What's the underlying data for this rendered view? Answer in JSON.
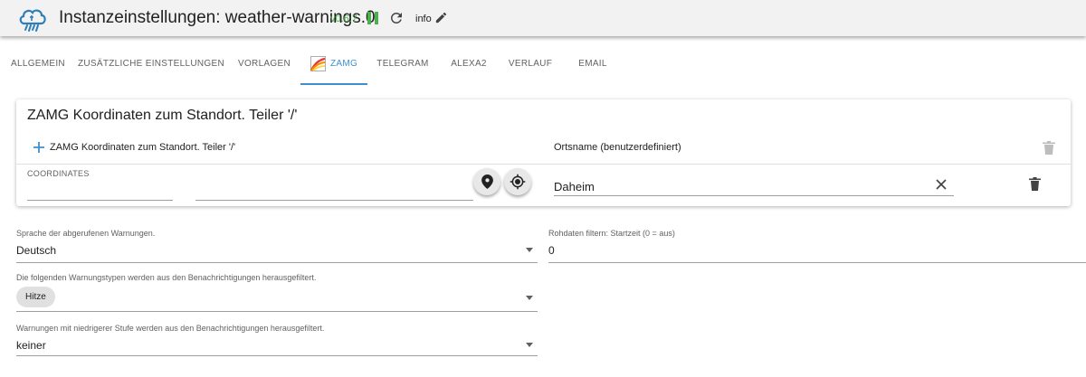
{
  "header": {
    "title": "Instanzeinstellungen: weather-warnings.0",
    "version": "v0.6.7",
    "info_label": "info",
    "colors": {
      "background": "#f2f2f2",
      "version": "#4caf50",
      "accent": "#3f8fcf"
    },
    "icons": [
      "app-logo-icon",
      "pause-icon",
      "refresh-icon",
      "pencil-icon"
    ]
  },
  "tabs": [
    {
      "label": "ALLGEMEIN",
      "active": false
    },
    {
      "label": "ZUSÄTZLICHE EINSTELLUNGEN",
      "active": false
    },
    {
      "label": "VORLAGEN",
      "active": false
    },
    {
      "label": "ZAMG",
      "active": true
    },
    {
      "label": "TELEGRAM",
      "active": false
    },
    {
      "label": "ALEXA2",
      "active": false
    },
    {
      "label": "VERLAUF",
      "active": false
    },
    {
      "label": "EMAIL",
      "active": false
    }
  ],
  "zamg_card": {
    "title": "ZAMG Koordinaten zum Standort. Teiler '/'",
    "add_label": "ZAMG Koordinaten zum Standort. Teiler '/'",
    "column_ortsname": "Ortsname (benutzerdefiniert)",
    "row": {
      "coordinates_label": "COORDINATES",
      "coordinate_1": "",
      "coordinate_2": "",
      "ortsname": "Daheim"
    }
  },
  "fields": {
    "language": {
      "label": "Sprache der abgerufenen Warnungen.",
      "value": "Deutsch"
    },
    "raw_filter": {
      "label": "Rohdaten filtern: Startzeit (0 = aus)",
      "value": "0"
    },
    "warning_types": {
      "label": "Die folgenden Warnungstypen werden aus den Benachrichtigungen herausgefiltert.",
      "chips": [
        "Hitze"
      ]
    },
    "lower_level": {
      "label": "Warnungen mit niedrigerer Stufe werden aus den Benachrichtigungen herausgefiltert.",
      "value": "keiner"
    }
  }
}
